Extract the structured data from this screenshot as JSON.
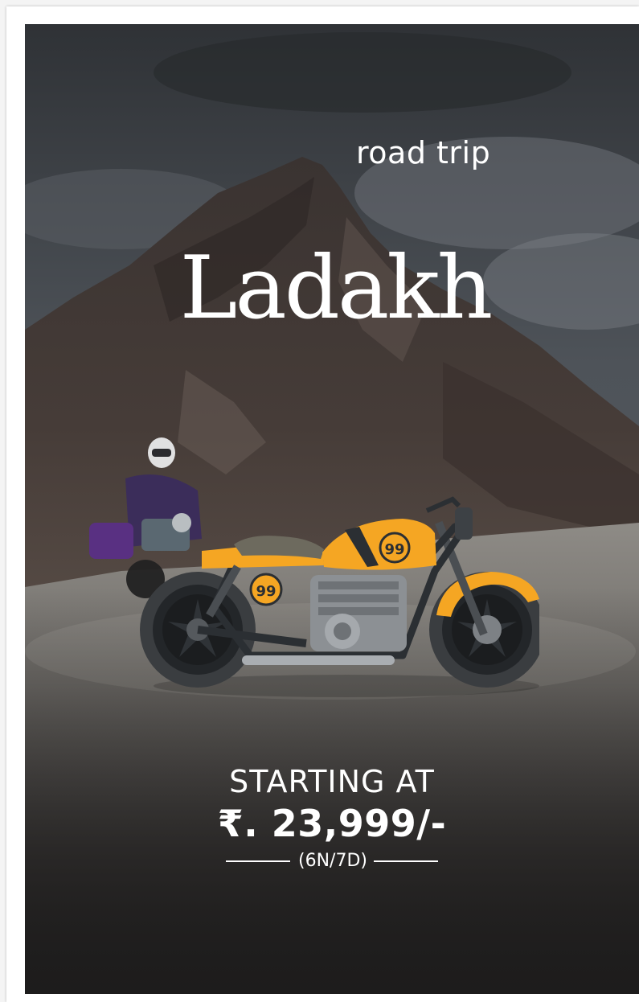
{
  "poster": {
    "trip_type": "road trip",
    "destination": "Ladakh",
    "starting_label": "STARTING AT",
    "price": "₹. 23,999/-",
    "duration": "(6N/7D)",
    "bike_tank_number": "99",
    "bike_side_number": "99"
  },
  "colors": {
    "text": "#ffffff",
    "bike_accent": "#f5a623",
    "bike_dark": "#2b2f33",
    "sky": "#4a4f55",
    "ground": "#8f8c87"
  },
  "icons": {
    "vehicle": "motorcycle-illustration"
  }
}
